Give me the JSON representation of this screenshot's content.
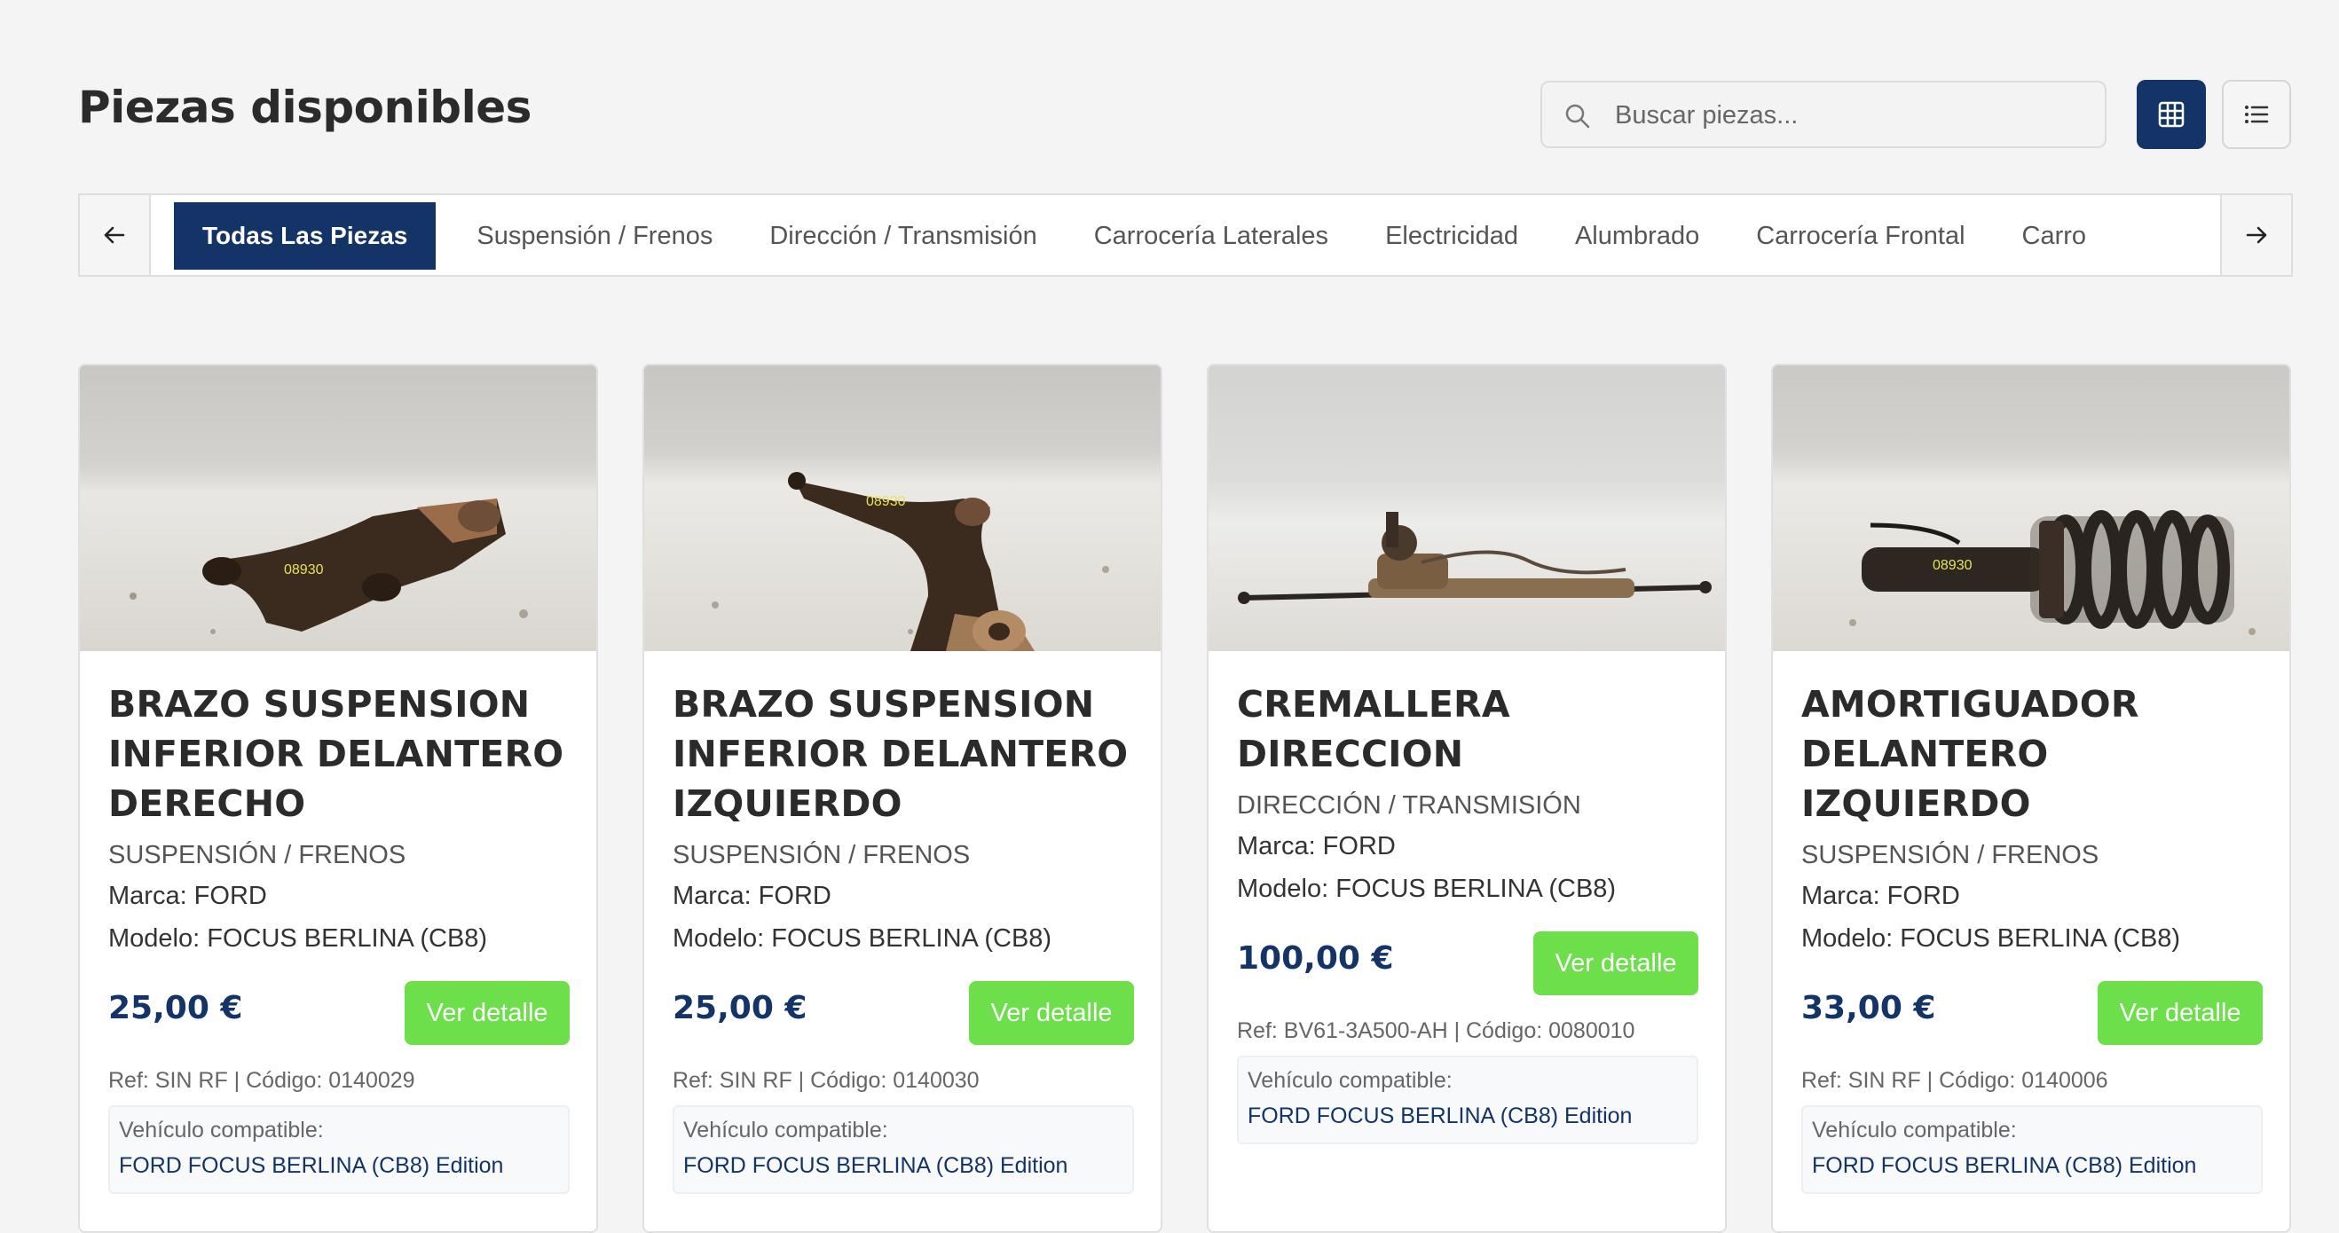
{
  "header": {
    "title": "Piezas disponibles",
    "search_placeholder": "Buscar piezas...",
    "view_icons": [
      "grid-view-icon",
      "list-view-icon"
    ]
  },
  "tabs": [
    {
      "label": "Todas Las Piezas",
      "active": true
    },
    {
      "label": "Suspensión / Frenos"
    },
    {
      "label": "Dirección / Transmisión"
    },
    {
      "label": "Carrocería Laterales"
    },
    {
      "label": "Electricidad"
    },
    {
      "label": "Alumbrado"
    },
    {
      "label": "Carrocería Frontal"
    },
    {
      "label": "Carro"
    }
  ],
  "colors": {
    "primary": "#143467",
    "accent_green": "#6ddf4b"
  },
  "cards": [
    {
      "title": "BRAZO SUSPENSION INFERIOR DELANTERO DERECHO",
      "category": "SUSPENSIÓN / FRENOS",
      "marca": "Marca: FORD",
      "modelo": "Modelo: FOCUS BERLINA (CB8)",
      "price": "25,00 €",
      "button": "Ver detalle",
      "ref": "Ref: SIN RF | Código: 0140029",
      "compat_label": "Vehículo compatible:",
      "compat_vehicle": "FORD FOCUS BERLINA (CB8) Edition"
    },
    {
      "title": "BRAZO SUSPENSION INFERIOR DELANTERO IZQUIERDO",
      "category": "SUSPENSIÓN / FRENOS",
      "marca": "Marca: FORD",
      "modelo": "Modelo: FOCUS BERLINA (CB8)",
      "price": "25,00 €",
      "button": "Ver detalle",
      "ref": "Ref: SIN RF | Código: 0140030",
      "compat_label": "Vehículo compatible:",
      "compat_vehicle": "FORD FOCUS BERLINA (CB8) Edition"
    },
    {
      "title": "CREMALLERA DIRECCION",
      "category": "DIRECCIÓN / TRANSMISIÓN",
      "marca": "Marca: FORD",
      "modelo": "Modelo: FOCUS BERLINA (CB8)",
      "price": "100,00 €",
      "button": "Ver detalle",
      "ref": "Ref: BV61-3A500-AH | Código: 0080010",
      "compat_label": "Vehículo compatible:",
      "compat_vehicle": "FORD FOCUS BERLINA (CB8) Edition"
    },
    {
      "title": "AMORTIGUADOR DELANTERO IZQUIERDO",
      "category": "SUSPENSIÓN / FRENOS",
      "marca": "Marca: FORD",
      "modelo": "Modelo: FOCUS BERLINA (CB8)",
      "price": "33,00 €",
      "button": "Ver detalle",
      "ref": "Ref: SIN RF | Código: 0140006",
      "compat_label": "Vehículo compatible:",
      "compat_vehicle": "FORD FOCUS BERLINA (CB8) Edition"
    }
  ]
}
